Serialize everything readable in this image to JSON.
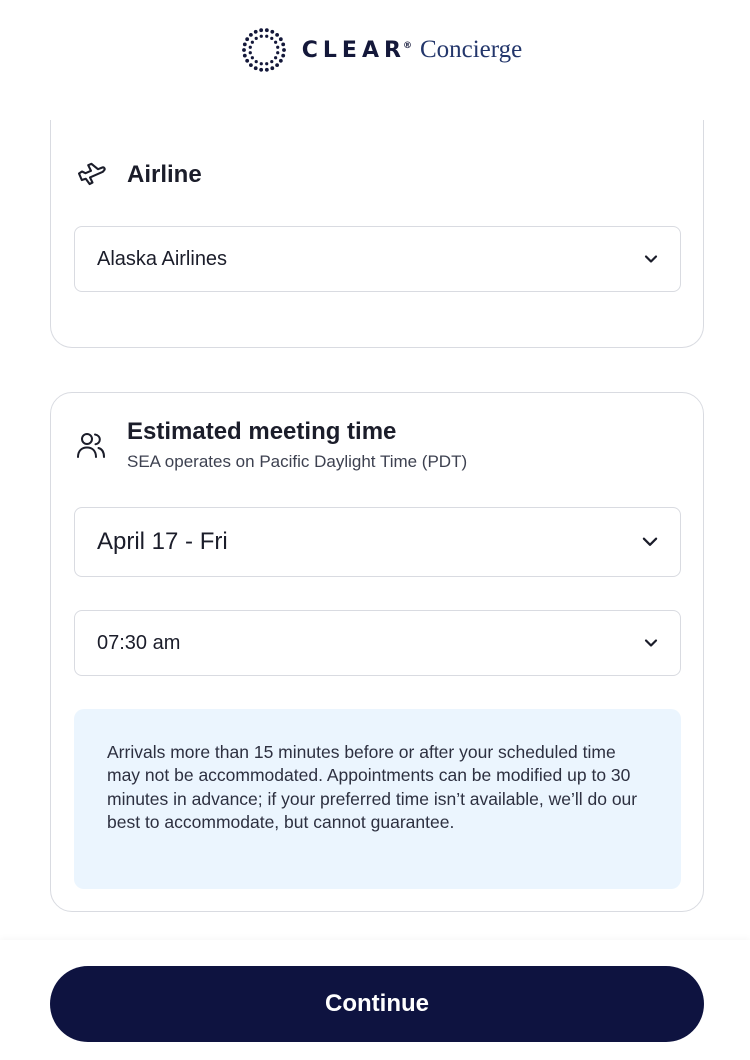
{
  "brand": {
    "name": "CLEAR",
    "registered": "®",
    "product": "Concierge"
  },
  "airline": {
    "title": "Airline",
    "icon": "airplane-icon",
    "selected": "Alaska Airlines"
  },
  "meeting": {
    "title": "Estimated meeting time",
    "subtitle": "SEA operates on Pacific Daylight Time (PDT)",
    "icon": "people-icon",
    "date": "April 17 - Fri",
    "time": "07:30 am",
    "notice": "Arrivals more than 15 minutes before or after your scheduled time may not be accommodated. Appointments can be modified up to 30 minutes in advance; if your preferred time isn’t available, we’ll do our best to accommodate, but cannot guarantee."
  },
  "footer": {
    "continue_label": "Continue"
  },
  "colors": {
    "primary": "#0e1340",
    "notice_bg": "#ebf5fe",
    "border": "#d9dbe1",
    "brand_text": "#14183a",
    "brand_concierge": "#23366b"
  }
}
